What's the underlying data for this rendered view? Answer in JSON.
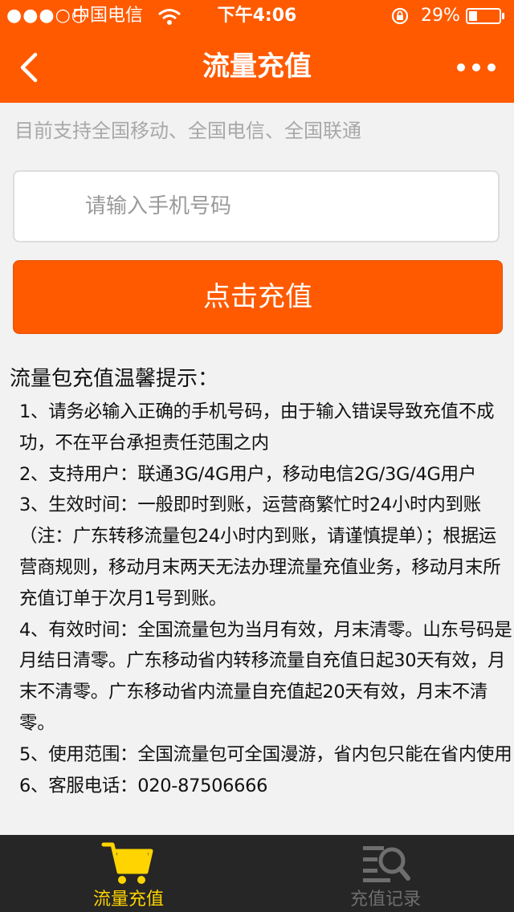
{
  "status_bar": {
    "signal": "●●●○○",
    "carrier": "中国电信",
    "time": "下午4:06",
    "battery_percent": "29%",
    "battery_level": 0.29
  },
  "nav": {
    "title": "流量充值",
    "back_icon": "chevron-left-icon",
    "more_icon": "more-horizontal-icon"
  },
  "support_note": "目前支持全国移动、全国电信、全国联通",
  "phone_input": {
    "placeholder": "请输入手机号码",
    "value": ""
  },
  "recharge_button": "点击充值",
  "tips": {
    "title": "流量包充值温馨提示：",
    "items": [
      "1、请务必输入正确的手机号码，由于输入错误导致充值不成功，不在平台承担责任范围之内",
      "2、支持用户：联通3G/4G用户，移动电信2G/3G/4G用户",
      "3、生效时间：一般即时到账，运营商繁忙时24小时内到账（注：广东转移流量包24小时内到账，请谨慎提单）；根据运营商规则，移动月末两天无法办理流量充值业务，移动月末所充值订单于次月1号到账。",
      "4、有效时间：全国流量包为当月有效，月末清零。山东号码是月结日清零。广东移动省内转移流量自充值日起30天有效，月末不清零。广东移动省内流量自充值起20天有效，月末不清零。",
      "5、使用范围：全国流量包可全国漫游，省内包只能在省内使用",
      "6、客服电话：020-87506666"
    ]
  },
  "tab_bar": {
    "tabs": [
      {
        "label": "流量充值",
        "icon": "cart-icon",
        "active": true
      },
      {
        "label": "充值记录",
        "icon": "search-list-icon",
        "active": false
      }
    ],
    "active_color": "#ffd400",
    "inactive_color": "#6e6e6e"
  },
  "colors": {
    "brand": "#ff5a00"
  }
}
